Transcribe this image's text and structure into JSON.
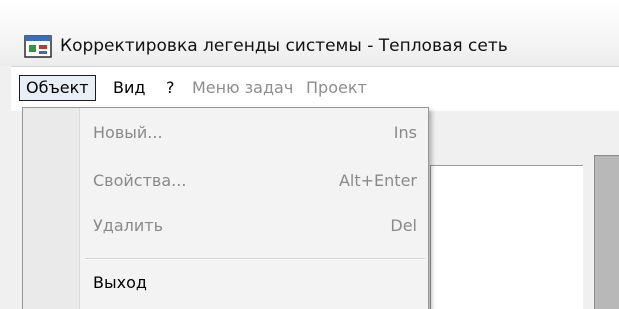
{
  "window": {
    "title": "Корректировка легенды системы - Тепловая сеть",
    "icon": "app-window-icon"
  },
  "menubar": {
    "items": [
      {
        "label": "Объект",
        "state": "active"
      },
      {
        "label": "Вид",
        "state": "enabled"
      },
      {
        "label": "?",
        "state": "enabled"
      },
      {
        "label": "Меню задач",
        "state": "disabled"
      },
      {
        "label": "Проект",
        "state": "disabled"
      }
    ]
  },
  "object_menu": {
    "items": [
      {
        "label": "Новый...",
        "shortcut": "Ins",
        "enabled": false
      },
      {
        "label": "Свойства...",
        "shortcut": "Alt+Enter",
        "enabled": false
      },
      {
        "label": "Удалить",
        "shortcut": "Del",
        "enabled": false
      },
      {
        "label": "Выход",
        "shortcut": "",
        "enabled": true
      }
    ]
  },
  "colors": {
    "disabled_text": "#8a8a8a",
    "active_menu_bg": "#e8eef6"
  }
}
